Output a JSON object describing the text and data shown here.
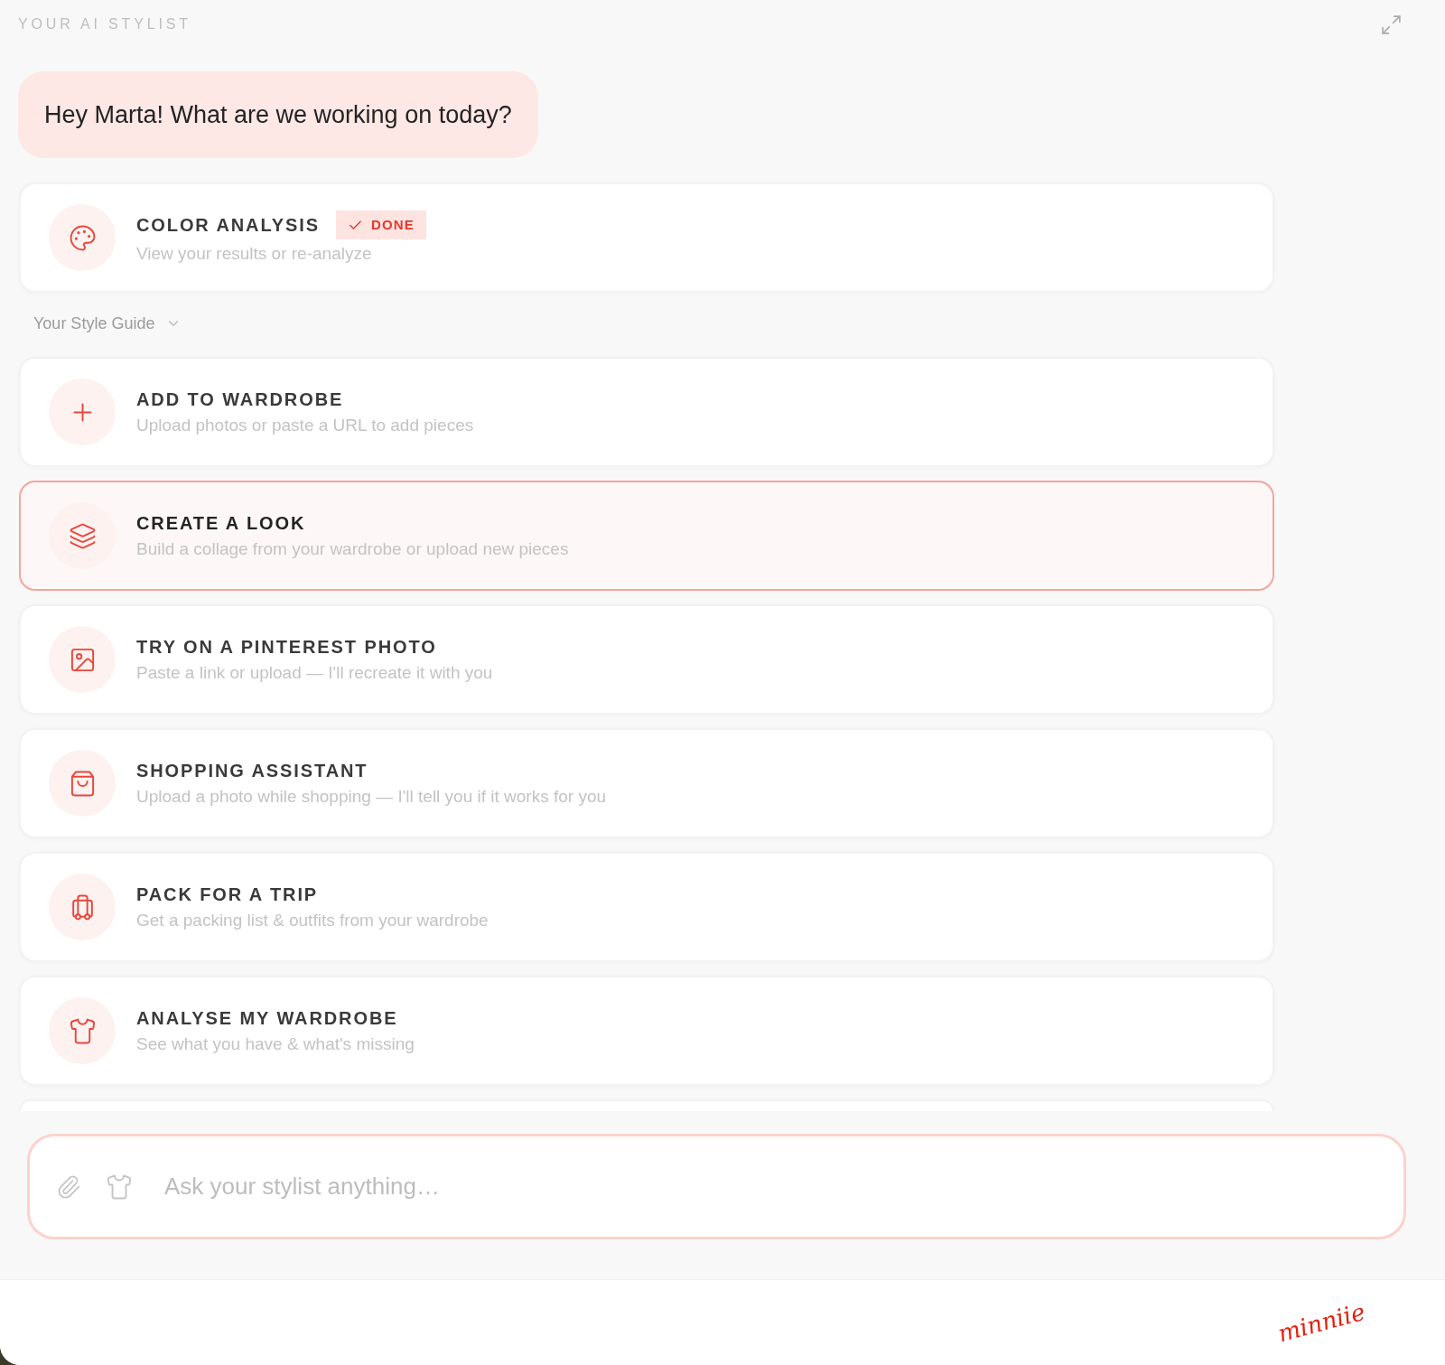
{
  "header": {
    "title": "YOUR AI STYLIST"
  },
  "greeting": "Hey Marta! What are we working on today?",
  "color_analysis": {
    "title": "COLOR ANALYSIS",
    "subtitle": "View your results or re-analyze",
    "badge": "DONE"
  },
  "style_guide": {
    "label": "Your Style Guide",
    "expanded": false
  },
  "actions": [
    {
      "title": "ADD TO WARDROBE",
      "subtitle": "Upload photos or paste a URL to add pieces",
      "selected": false
    },
    {
      "title": "CREATE A LOOK",
      "subtitle": "Build a collage from your wardrobe or upload new pieces",
      "selected": true
    },
    {
      "title": "TRY ON A PINTEREST PHOTO",
      "subtitle": "Paste a link or upload — I'll recreate it with you",
      "selected": false
    },
    {
      "title": "SHOPPING ASSISTANT",
      "subtitle": "Upload a photo while shopping — I'll tell you if it works for you",
      "selected": false
    },
    {
      "title": "PACK FOR A TRIP",
      "subtitle": "Get a packing list & outfits from your wardrobe",
      "selected": false
    },
    {
      "title": "ANALYSE MY WARDROBE",
      "subtitle": "See what you have & what's missing",
      "selected": false
    }
  ],
  "composer": {
    "placeholder": "Ask your stylist anything…"
  },
  "footer": {
    "logo": "minniie"
  }
}
